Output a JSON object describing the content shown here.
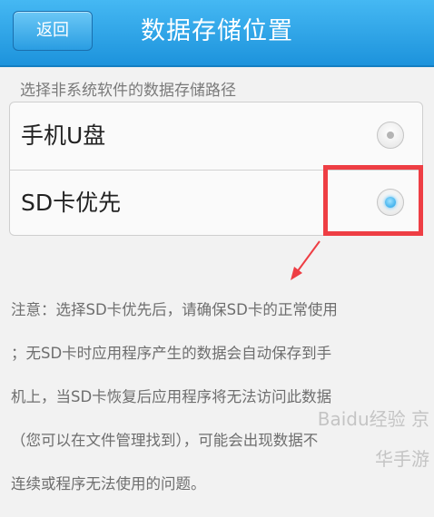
{
  "header": {
    "back_label": "返回",
    "title": "数据存储位置"
  },
  "section_label": "选择非系统软件的数据存储路径",
  "options": [
    {
      "label": "手机U盘",
      "selected": false
    },
    {
      "label": "SD卡优先",
      "selected": true
    }
  ],
  "note": {
    "lines": [
      "注意：选择SD卡优先后，请确保SD卡的正常使用",
      "；无SD卡时应用程序产生的数据会自动保存到手",
      "机上，当SD卡恢复后应用程序将无法访问此数据",
      "（您可以在文件管理找到），可能会出现数据不",
      "连续或程序无法使用的问题。"
    ]
  },
  "annotation_color": "#ee3e44",
  "accent_color": "#1d93dc",
  "watermark": "Baidu经验 京华手游"
}
